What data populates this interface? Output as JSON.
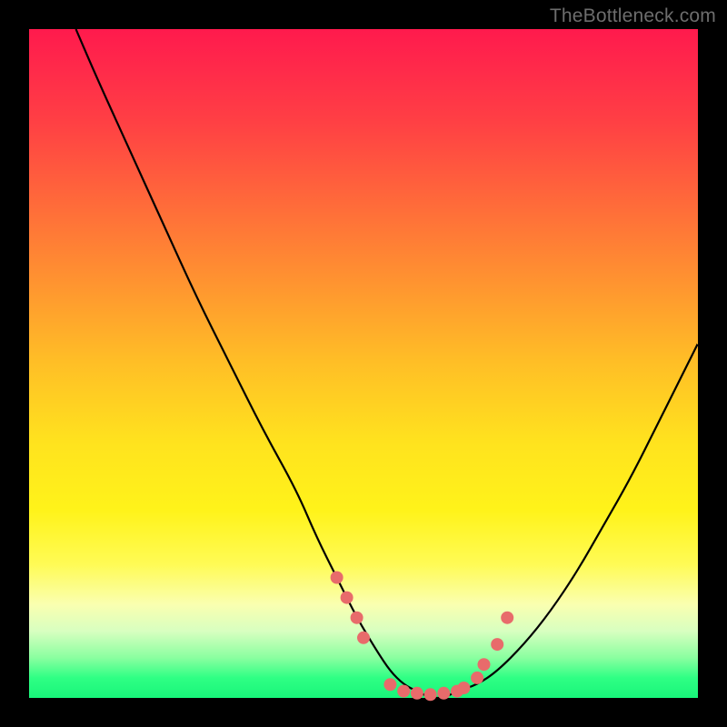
{
  "watermark": "TheBottleneck.com",
  "chart_data": {
    "type": "line",
    "title": "",
    "xlabel": "",
    "ylabel": "",
    "xlim": [
      0,
      100
    ],
    "ylim": [
      0,
      100
    ],
    "series": [
      {
        "name": "curve",
        "x": [
          7,
          10,
          15,
          20,
          25,
          30,
          35,
          40,
          43,
          46,
          49,
          52,
          54,
          56,
          58,
          60,
          62,
          64,
          67,
          70,
          74,
          78,
          82,
          86,
          90,
          94,
          97,
          100
        ],
        "y": [
          100,
          93,
          82,
          71,
          60,
          50,
          40,
          31,
          24,
          18,
          12,
          7,
          4,
          2,
          1,
          0,
          0,
          1,
          2,
          4,
          8,
          13,
          19,
          26,
          33,
          41,
          47,
          53
        ]
      }
    ],
    "markers": {
      "name": "dots",
      "color": "#e86b6b",
      "x": [
        46,
        47.5,
        49,
        50,
        54,
        56,
        58,
        60,
        62,
        64,
        65,
        67,
        68,
        70,
        71.5
      ],
      "y": [
        18,
        15,
        12,
        9,
        2,
        1,
        0.7,
        0.5,
        0.7,
        1,
        1.5,
        3,
        5,
        8,
        12
      ]
    }
  }
}
